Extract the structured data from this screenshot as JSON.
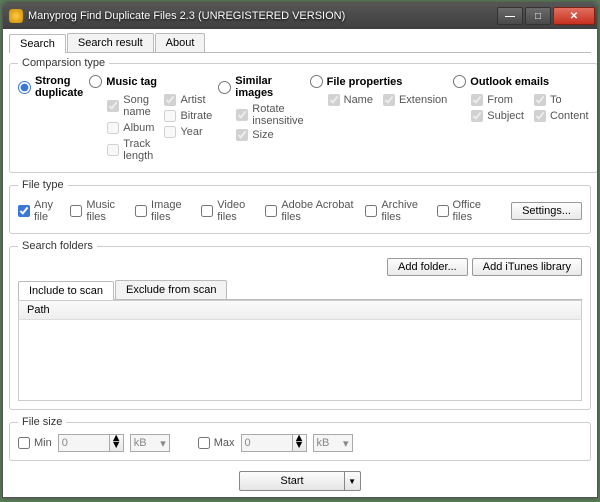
{
  "window": {
    "title": "Manyprog Find Duplicate Files 2.3 (UNREGISTERED VERSION)"
  },
  "tabs": {
    "search": "Search",
    "result": "Search result",
    "about": "About"
  },
  "comparison": {
    "legend": "Comparsion type",
    "strong": {
      "label": "Strong duplicate"
    },
    "music": {
      "label": "Music tag",
      "song": "Song name",
      "artist": "Artist",
      "album": "Album",
      "bitrate": "Bitrate",
      "track": "Track length",
      "year": "Year"
    },
    "similar": {
      "label": "Similar images",
      "rotate": "Rotate insensitive",
      "size": "Size"
    },
    "props": {
      "label": "File properties",
      "name": "Name",
      "ext": "Extension"
    },
    "outlook": {
      "label": "Outlook emails",
      "from": "From",
      "to": "To",
      "subject": "Subject",
      "content": "Content"
    }
  },
  "filetype": {
    "legend": "File type",
    "any": "Any file",
    "music": "Music files",
    "image": "Image files",
    "video": "Video files",
    "pdf": "Adobe Acrobat files",
    "archive": "Archive files",
    "office": "Office files",
    "settings": "Settings..."
  },
  "folders": {
    "legend": "Search folders",
    "add": "Add folder...",
    "itunes": "Add iTunes library",
    "include": "Include to scan",
    "exclude": "Exclude from scan",
    "path": "Path"
  },
  "filesize": {
    "legend": "File size",
    "min": "Min",
    "max": "Max",
    "val": "0",
    "unit": "kB"
  },
  "start": "Start"
}
